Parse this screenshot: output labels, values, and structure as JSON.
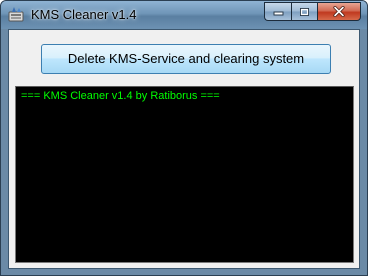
{
  "window": {
    "title": "KMS Cleaner v1.4",
    "app_icon": "cleaner-app-icon",
    "controls": {
      "minimize": "minimize-icon",
      "maximize": "maximize-icon",
      "close": "close-icon"
    }
  },
  "main": {
    "action_button_label": "Delete KMS-Service and clearing system",
    "console_lines": [
      "=== KMS Cleaner v1.4 by Ratiborus ==="
    ]
  },
  "colors": {
    "console_background": "#000000",
    "console_text": "#00ff00",
    "close_button": "#c0391f"
  }
}
